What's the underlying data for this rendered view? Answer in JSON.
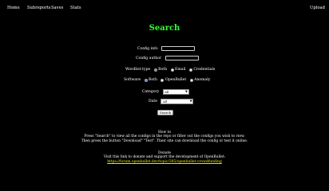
{
  "nav": {
    "home": "Home",
    "subreports": "Subreports",
    "saves": "Saves",
    "stats": "Stats",
    "upload": "Upload"
  },
  "page": {
    "title": "Search"
  },
  "form": {
    "config_info_label": "Config info",
    "config_info_value": "",
    "config_author_label": "Config author",
    "config_author_value": "",
    "wordlist_type_label": "Wordlist-type",
    "wordlist_options": [
      "Both",
      "Email",
      "Credentials"
    ],
    "wordlist_selected": "Both",
    "software_label": "Software",
    "software_options": [
      "Both",
      "OpenBullet",
      "Anomaly"
    ],
    "software_selected": "Both",
    "category_label": "Category",
    "category_value": "All",
    "date_label": "Date",
    "date_value": "All",
    "search_button": "Search"
  },
  "info": {
    "howto_title": "How to",
    "howto_line1": "Press \"Search\" to view all the configs in the repo or filter out the configs you wish to view.",
    "howto_line2": "Then press the button \"Download\" \"Test\". Their site can download the config or test it online.",
    "donate_title": "Donate",
    "donate_line": "Visit this link to donate and support the development of OpenBullet:",
    "donate_link": "https://forum.openbullet.dev/topic/385/openbullet-crowdfunding"
  },
  "colors": {
    "title": "#33ff33",
    "link": "#e6e600",
    "background": "#000000"
  }
}
